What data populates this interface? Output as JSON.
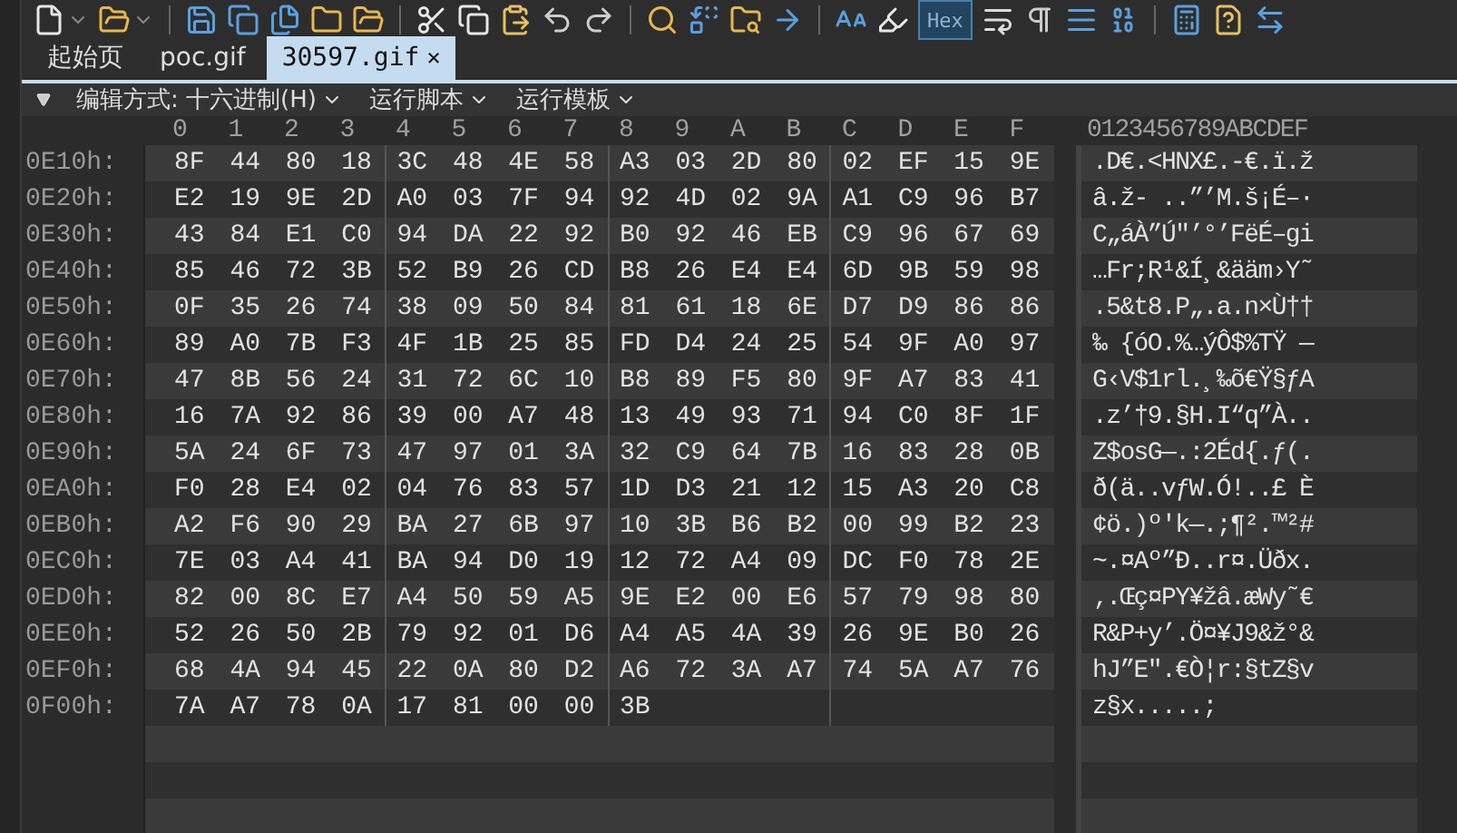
{
  "toolbar": {
    "hex_toggle": {
      "label": "Hex",
      "selected": true
    }
  },
  "tabs": [
    {
      "label": "起始页",
      "selected": false
    },
    {
      "label": "poc.gif",
      "selected": false
    },
    {
      "label": "30597.gif",
      "selected": true,
      "close": "×"
    }
  ],
  "menu": [
    "编辑方式: 十六进制(H)",
    "运行脚本",
    "运行模板"
  ],
  "hex_header": [
    "0",
    "1",
    "2",
    "3",
    "4",
    "5",
    "6",
    "7",
    "8",
    "9",
    "A",
    "B",
    "C",
    "D",
    "E",
    "F"
  ],
  "text_header": "0123456789ABCDEF",
  "rows": [
    {
      "address": "0E10h:",
      "bytes": [
        "8F",
        "44",
        "80",
        "18",
        "3C",
        "48",
        "4E",
        "58",
        "A3",
        "03",
        "2D",
        "80",
        "02",
        "EF",
        "15",
        "9E"
      ],
      "text": ".D€.<HNX£.-€.ï.ž"
    },
    {
      "address": "0E20h:",
      "bytes": [
        "E2",
        "19",
        "9E",
        "2D",
        "A0",
        "03",
        "7F",
        "94",
        "92",
        "4D",
        "02",
        "9A",
        "A1",
        "C9",
        "96",
        "B7"
      ],
      "text": "â.ž- ..”’M.š¡É–·"
    },
    {
      "address": "0E30h:",
      "bytes": [
        "43",
        "84",
        "E1",
        "C0",
        "94",
        "DA",
        "22",
        "92",
        "B0",
        "92",
        "46",
        "EB",
        "C9",
        "96",
        "67",
        "69"
      ],
      "text": "C„áÀ”Ú\"’°’FëÉ–gi"
    },
    {
      "address": "0E40h:",
      "bytes": [
        "85",
        "46",
        "72",
        "3B",
        "52",
        "B9",
        "26",
        "CD",
        "B8",
        "26",
        "E4",
        "E4",
        "6D",
        "9B",
        "59",
        "98"
      ],
      "text": "…Fr;R¹&Í¸&ääm›Y˜"
    },
    {
      "address": "0E50h:",
      "bytes": [
        "0F",
        "35",
        "26",
        "74",
        "38",
        "09",
        "50",
        "84",
        "81",
        "61",
        "18",
        "6E",
        "D7",
        "D9",
        "86",
        "86"
      ],
      "text": ".5&t8.P„.a.n×Ù††"
    },
    {
      "address": "0E60h:",
      "bytes": [
        "89",
        "A0",
        "7B",
        "F3",
        "4F",
        "1B",
        "25",
        "85",
        "FD",
        "D4",
        "24",
        "25",
        "54",
        "9F",
        "A0",
        "97"
      ],
      "text": "‰ {óO.%…ýÔ$%TŸ —"
    },
    {
      "address": "0E70h:",
      "bytes": [
        "47",
        "8B",
        "56",
        "24",
        "31",
        "72",
        "6C",
        "10",
        "B8",
        "89",
        "F5",
        "80",
        "9F",
        "A7",
        "83",
        "41"
      ],
      "text": "G‹V$1rl.¸‰õ€Ÿ§ƒA"
    },
    {
      "address": "0E80h:",
      "bytes": [
        "16",
        "7A",
        "92",
        "86",
        "39",
        "00",
        "A7",
        "48",
        "13",
        "49",
        "93",
        "71",
        "94",
        "C0",
        "8F",
        "1F"
      ],
      "text": ".z’†9.§H.I“q”À.."
    },
    {
      "address": "0E90h:",
      "bytes": [
        "5A",
        "24",
        "6F",
        "73",
        "47",
        "97",
        "01",
        "3A",
        "32",
        "C9",
        "64",
        "7B",
        "16",
        "83",
        "28",
        "0B"
      ],
      "text": "Z$osG—.:2Éd{.ƒ(."
    },
    {
      "address": "0EA0h:",
      "bytes": [
        "F0",
        "28",
        "E4",
        "02",
        "04",
        "76",
        "83",
        "57",
        "1D",
        "D3",
        "21",
        "12",
        "15",
        "A3",
        "20",
        "C8"
      ],
      "text": "ð(ä..vƒW.Ó!..£ È"
    },
    {
      "address": "0EB0h:",
      "bytes": [
        "A2",
        "F6",
        "90",
        "29",
        "BA",
        "27",
        "6B",
        "97",
        "10",
        "3B",
        "B6",
        "B2",
        "00",
        "99",
        "B2",
        "23"
      ],
      "text": "¢ö.)º'k—.;¶².™²#"
    },
    {
      "address": "0EC0h:",
      "bytes": [
        "7E",
        "03",
        "A4",
        "41",
        "BA",
        "94",
        "D0",
        "19",
        "12",
        "72",
        "A4",
        "09",
        "DC",
        "F0",
        "78",
        "2E"
      ],
      "text": "~.¤Aº”Ð..r¤.Üðx."
    },
    {
      "address": "0ED0h:",
      "bytes": [
        "82",
        "00",
        "8C",
        "E7",
        "A4",
        "50",
        "59",
        "A5",
        "9E",
        "E2",
        "00",
        "E6",
        "57",
        "79",
        "98",
        "80"
      ],
      "text": "‚.Œç¤PY¥žâ.æWy˜€"
    },
    {
      "address": "0EE0h:",
      "bytes": [
        "52",
        "26",
        "50",
        "2B",
        "79",
        "92",
        "01",
        "D6",
        "A4",
        "A5",
        "4A",
        "39",
        "26",
        "9E",
        "B0",
        "26"
      ],
      "text": "R&P+y’.Ö¤¥J9&ž°&"
    },
    {
      "address": "0EF0h:",
      "bytes": [
        "68",
        "4A",
        "94",
        "45",
        "22",
        "0A",
        "80",
        "D2",
        "A6",
        "72",
        "3A",
        "A7",
        "74",
        "5A",
        "A7",
        "76"
      ],
      "text": "hJ”E\".€Ò¦r:§tZ§v"
    },
    {
      "address": "0F00h:",
      "bytes": [
        "7A",
        "A7",
        "78",
        "0A",
        "17",
        "81",
        "00",
        "00",
        "3B"
      ],
      "text": "z§x.....;"
    }
  ]
}
